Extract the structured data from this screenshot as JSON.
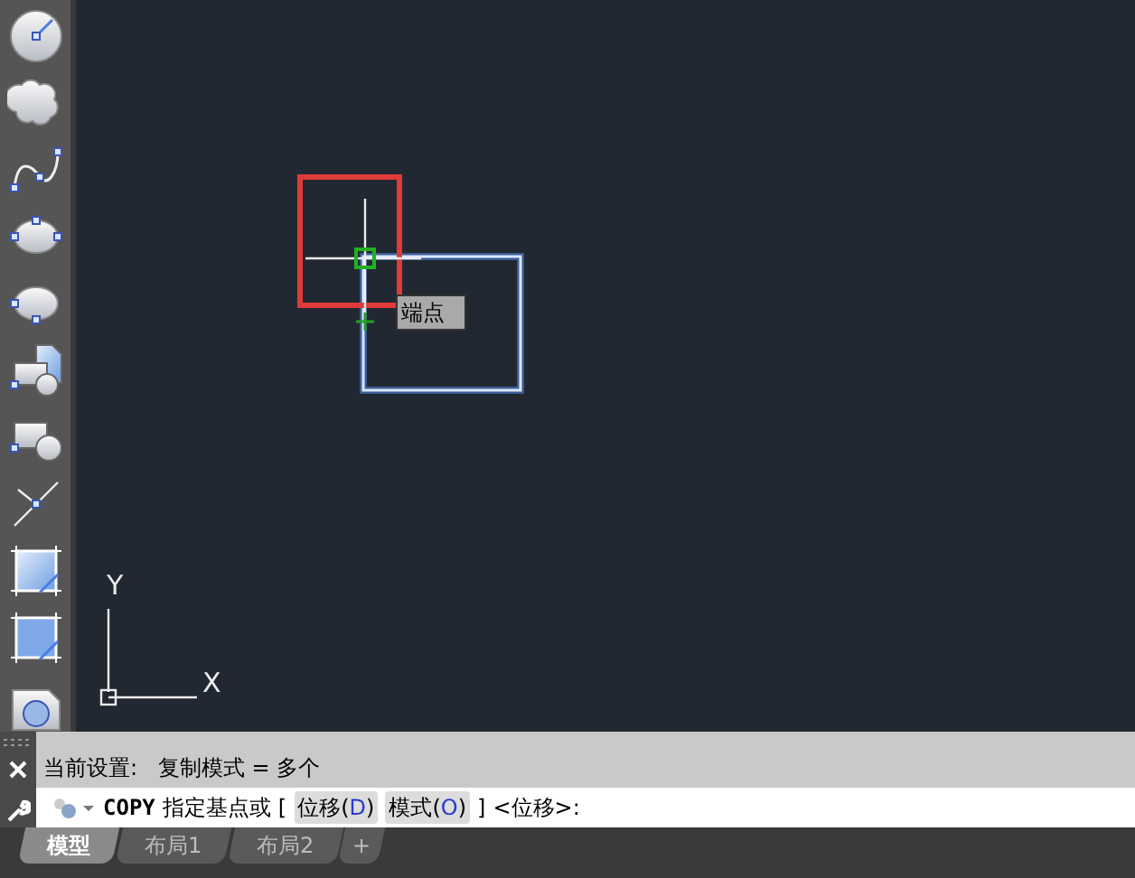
{
  "canvas": {
    "tooltip": "端点",
    "ucs": {
      "x_label": "X",
      "y_label": "Y"
    }
  },
  "command_line": {
    "history": "当前设置:   复制模式 = 多个",
    "command": "COPY",
    "prompt": "指定基点或",
    "open_bracket": "[",
    "options": [
      {
        "prefix": "位移(",
        "key": "D",
        "suffix": ")"
      },
      {
        "prefix": "模式(",
        "key": "O",
        "suffix": ")"
      }
    ],
    "close_bracket": "]",
    "default": "<位移>:"
  },
  "tabs": [
    {
      "label": "模型",
      "selected": true
    },
    {
      "label": "布局1",
      "selected": false
    },
    {
      "label": "布局2",
      "selected": false
    },
    {
      "label": "+",
      "selected": false
    }
  ]
}
